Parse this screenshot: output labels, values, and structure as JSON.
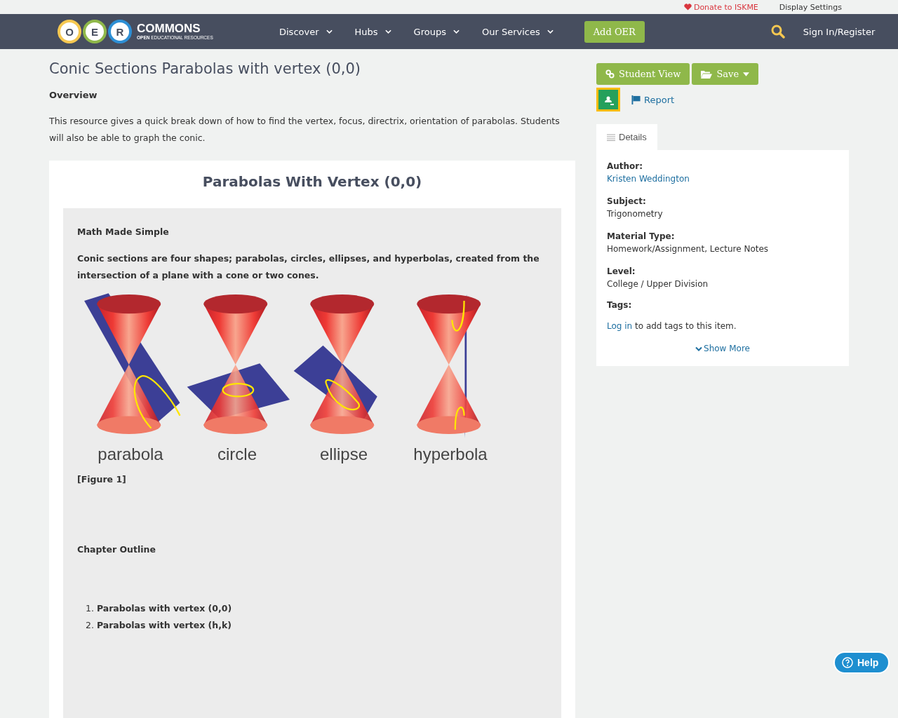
{
  "top_bar": {
    "donate": "Donate to ISKME",
    "display_settings": "Display Settings"
  },
  "nav": {
    "logo": {
      "letters": [
        {
          "text": "O",
          "color": "#f6c851"
        },
        {
          "text": "E",
          "color": "#8fb84a"
        },
        {
          "text": "R",
          "color": "#2d8fd5"
        }
      ],
      "name": "COMMONS",
      "tagline_bold": "OPEN",
      "tagline": "EDUCATIONAL RESOURCES"
    },
    "menu": [
      "Discover",
      "Hubs",
      "Groups",
      "Our Services"
    ],
    "add_button": "Add OER",
    "sign_in": "Sign In/Register"
  },
  "resource": {
    "title": "Conic Sections Parabolas with vertex (0,0)",
    "overview_heading": "Overview",
    "overview": "This resource gives a quick break down of how to find the vertex, focus, directrix, orientation of parabolas. Students will also be able to graph the conic.",
    "content": {
      "heading": "Parabolas With Vertex (0,0)",
      "subheading": "Math Made Simple",
      "intro": "Conic sections are four shapes; parabolas, circles, ellipses, and hyperbolas, created from the intersection of a plane with a cone or two cones.",
      "figure": [
        {
          "kind": "parabola",
          "label": "parabola"
        },
        {
          "kind": "circle",
          "label": "circle"
        },
        {
          "kind": "ellipse",
          "label": "ellipse"
        },
        {
          "kind": "hyperbola",
          "label": "hyperbola"
        }
      ],
      "figure_caption": "[Figure 1]",
      "outline_heading": "Chapter Outline",
      "outline": [
        {
          "number": "1.",
          "text": "Parabolas with vertex (0,0)"
        },
        {
          "number": "2.",
          "text": "Parabolas with vertex (h,k)"
        }
      ]
    }
  },
  "actions": {
    "student_view": "Student View",
    "save": "Save",
    "report": "Report"
  },
  "details": {
    "tab": "Details",
    "fields": [
      {
        "label": "Author:",
        "value": "Kristen Weddington",
        "link": true
      },
      {
        "label": "Subject:",
        "value": "Trigonometry",
        "link": false
      },
      {
        "label": "Material Type:",
        "value": "Homework/Assignment, Lecture Notes",
        "link": false
      },
      {
        "label": "Level:",
        "value": "College / Upper Division",
        "link": false
      }
    ],
    "tags_label": "Tags:",
    "login_link": "Log in",
    "login_text": "to add tags to this item.",
    "show_more": "Show More"
  },
  "help": "Help"
}
